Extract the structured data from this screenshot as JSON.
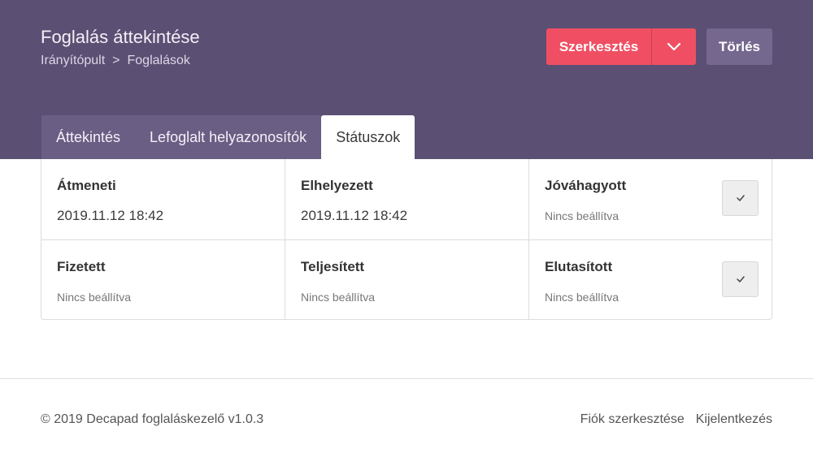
{
  "header": {
    "title": "Foglalás áttekintése",
    "breadcrumb": [
      "Irányítópult",
      ">",
      "Foglalások"
    ],
    "edit_label": "Szerkesztés",
    "delete_label": "Törlés",
    "accent_color": "#f04f63",
    "header_color": "#5b4f73"
  },
  "tabs": [
    {
      "label": "Áttekintés",
      "active": false
    },
    {
      "label": "Lefoglalt helyazonosítók",
      "active": false
    },
    {
      "label": "Státuszok",
      "active": true
    }
  ],
  "statuses": [
    {
      "label": "Átmeneti",
      "value": "2019.11.12 18:42"
    },
    {
      "label": "Elhelyezett",
      "value": "2019.11.12 18:42"
    },
    {
      "label": "Jóváhagyott",
      "value": "Nincs beállítva",
      "has_check_button": true
    },
    {
      "label": "Fizetett",
      "value": "Nincs beállítva"
    },
    {
      "label": "Teljesített",
      "value": "Nincs beállítva"
    },
    {
      "label": "Elutasított",
      "value": "Nincs beállítva",
      "has_check_button": true
    }
  ],
  "footer": {
    "copyright": "© 2019 Decapad foglaláskezelő v1.0.3",
    "links": [
      "Fiók szerkesztése",
      "Kijelentkezés"
    ]
  }
}
